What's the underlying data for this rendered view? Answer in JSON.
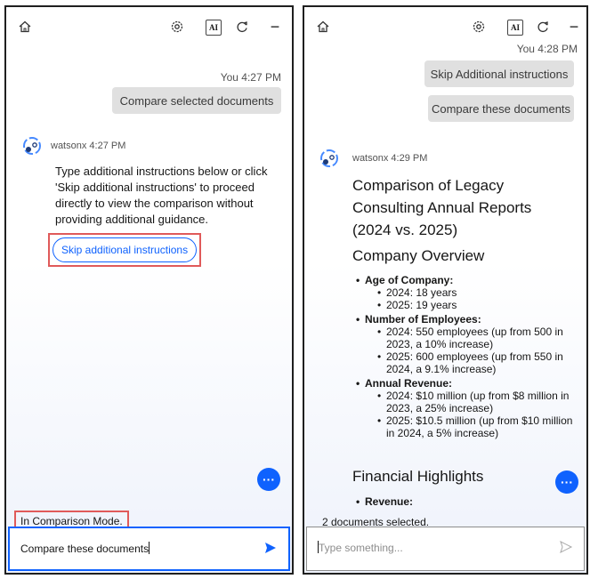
{
  "left": {
    "you_label": "You 4:27 PM",
    "user_message": "Compare selected documents",
    "bot_name": "watsonx 4:27 PM",
    "bot_message": "Type additional instructions below or click 'Skip additional instructions' to proceed directly to view the comparison without providing additional guidance.",
    "skip_button": "Skip additional instructions",
    "mode_text": "In Comparison Mode.",
    "input_value": "Compare these documents",
    "fab_label": "···"
  },
  "right": {
    "you_label": "You 4:28 PM",
    "user_messages": [
      "Skip Additional instructions",
      "Compare these documents"
    ],
    "bot_name": "watsonx 4:29 PM",
    "title_lines": [
      "Comparison of Legacy",
      "Consulting Annual Reports",
      "(2024 vs. 2025)"
    ],
    "section1": "Company Overview",
    "items": [
      {
        "label": "Age of Company:",
        "subs": [
          "2024: 18 years",
          "2025: 19 years"
        ]
      },
      {
        "label": "Number of Employees:",
        "subs": [
          "2024: 550 employees (up from 500 in 2023, a 10% increase)",
          "2025: 600 employees (up from 550 in 2024, a 9.1% increase)"
        ]
      },
      {
        "label": "Annual Revenue:",
        "subs": [
          "2024: $10 million (up from $8 million in 2023, a 25% increase)",
          "2025: $10.5 million (up from $10 million in 2024, a 5% increase)"
        ]
      }
    ],
    "section2": "Financial Highlights",
    "revenue_label": "Revenue:",
    "docs_selected": "2 documents selected.",
    "input_placeholder": "Type something...",
    "fab_label": "···"
  },
  "icons": [
    "home-icon",
    "settings-icon",
    "ai-icon",
    "refresh-icon",
    "minimize-icon",
    "send-icon"
  ],
  "colors": {
    "accent": "#0f62fe",
    "highlight_box": "#e05a5a",
    "bubble": "#e0e0e0"
  }
}
